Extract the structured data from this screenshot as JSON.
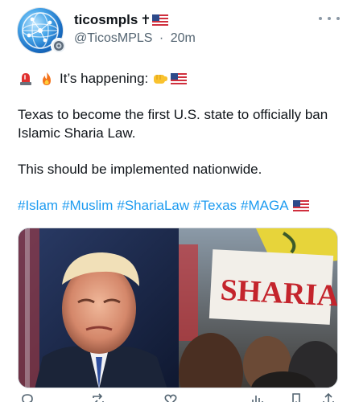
{
  "tweet": {
    "author": {
      "display_name": "ticosmpls",
      "name_suffix_glyph": "✝",
      "handle": "@TicosMPLS",
      "separator": "·",
      "time": "20m",
      "avatar_icon": "globe-network-avatar",
      "badge_icon": "seal-badge-icon"
    },
    "more_icon": "more-horizontal-icon",
    "text": {
      "line1_text": "It’s happening:",
      "line1_emojis_before": [
        "police-light-emoji",
        "fire-emoji"
      ],
      "line1_emojis_after": [
        "fist-bump-emoji",
        "us-flag-emoji"
      ],
      "paragraph2": "Texas to become the first U.S. state to officially ban Islamic Sharia Law.",
      "paragraph3": "This should be implemented nationwide.",
      "hashtags": [
        "#Islam",
        "#Muslim",
        "#ShariaLaw",
        "#Texas",
        "#MAGA"
      ],
      "hashtags_trailing_emoji": "us-flag-emoji"
    },
    "media": {
      "left_image": "portrait-photo",
      "right_image": "protest-crowd-photo",
      "right_image_sign_text": "SHARIA"
    },
    "actions": [
      "reply-icon",
      "retweet-icon",
      "like-icon",
      "views-icon",
      "bookmark-icon",
      "share-icon"
    ]
  },
  "colors": {
    "text_primary": "#0f1419",
    "text_secondary": "#536471",
    "link": "#1d9bf0",
    "background": "#ffffff"
  }
}
